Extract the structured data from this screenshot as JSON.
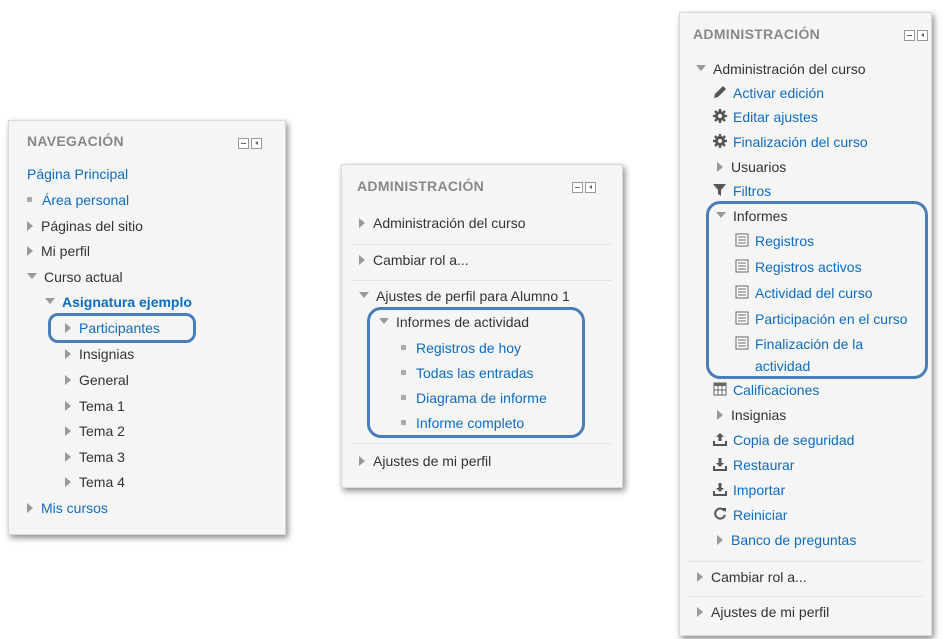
{
  "nav_block": {
    "title": "NAVEGACIÓN",
    "items": [
      {
        "label": "Página Principal"
      },
      {
        "label": "Área personal"
      },
      {
        "label": "Páginas del sitio"
      },
      {
        "label": "Mi perfil"
      },
      {
        "label": "Curso actual"
      },
      {
        "label": "Asignatura ejemplo"
      },
      {
        "label": "Participantes"
      },
      {
        "label": "Insignias"
      },
      {
        "label": "General"
      },
      {
        "label": "Tema 1"
      },
      {
        "label": "Tema 2"
      },
      {
        "label": "Tema 3"
      },
      {
        "label": "Tema 4"
      },
      {
        "label": "Mis cursos"
      }
    ]
  },
  "admin_small": {
    "title": "ADMINISTRACIÓN",
    "items": [
      {
        "label": "Administración del curso"
      },
      {
        "label": "Cambiar rol a..."
      },
      {
        "label": "Ajustes de perfil para Alumno 1"
      },
      {
        "label": "Informes de actividad"
      },
      {
        "label": "Registros de hoy"
      },
      {
        "label": "Todas las entradas"
      },
      {
        "label": "Diagrama de informe"
      },
      {
        "label": "Informe completo"
      },
      {
        "label": "Ajustes de mi perfil"
      }
    ]
  },
  "admin_large": {
    "title": "ADMINISTRACIÓN",
    "items": [
      {
        "label": "Administración del curso",
        "icon": "triangle-down-icon"
      },
      {
        "label": "Activar edición",
        "icon": "pencil-icon"
      },
      {
        "label": "Editar ajustes",
        "icon": "gear-icon"
      },
      {
        "label": "Finalización del curso",
        "icon": "gear-icon"
      },
      {
        "label": "Usuarios",
        "icon": "triangle-right-icon"
      },
      {
        "label": "Filtros",
        "icon": "filter-icon"
      },
      {
        "label": "Informes",
        "icon": "triangle-down-icon"
      },
      {
        "label": "Registros",
        "icon": "report-icon"
      },
      {
        "label": "Registros activos",
        "icon": "report-icon"
      },
      {
        "label": "Actividad del curso",
        "icon": "report-icon"
      },
      {
        "label": "Participación en el curso",
        "icon": "report-icon"
      },
      {
        "label": "Finalización de la",
        "icon": "report-icon"
      },
      {
        "label": "actividad"
      },
      {
        "label": "Calificaciones",
        "icon": "table-icon"
      },
      {
        "label": "Insignias",
        "icon": "triangle-right-icon"
      },
      {
        "label": "Copia de seguridad",
        "icon": "upload-icon"
      },
      {
        "label": "Restaurar",
        "icon": "download-icon"
      },
      {
        "label": "Importar",
        "icon": "download-icon"
      },
      {
        "label": "Reiniciar",
        "icon": "refresh-icon"
      },
      {
        "label": "Banco de preguntas",
        "icon": "triangle-right-icon"
      },
      {
        "label": "Cambiar rol a...",
        "icon": "triangle-right-icon"
      },
      {
        "label": "Ajustes de mi perfil",
        "icon": "triangle-right-icon"
      }
    ]
  },
  "colors": {
    "link": "#0f6cbf",
    "highlight": "#4a7ebb",
    "block_bg": "#f5f5f5"
  }
}
